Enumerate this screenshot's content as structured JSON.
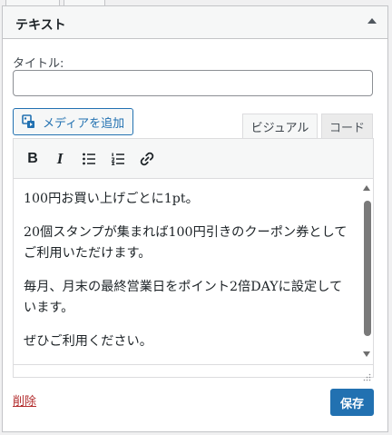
{
  "widget": {
    "title": "テキスト",
    "toggle_icon": "arrow-up-icon"
  },
  "form": {
    "title_label": "タイトル:",
    "title_value": "",
    "title_placeholder": ""
  },
  "media": {
    "button_label": "メディアを追加",
    "icon": "media-add-icon"
  },
  "editor": {
    "tabs": [
      {
        "label": "ビジュアル",
        "active": true
      },
      {
        "label": "コード",
        "active": false
      }
    ],
    "toolbar": [
      {
        "name": "bold",
        "glyph": "B"
      },
      {
        "name": "italic",
        "glyph": "I"
      },
      {
        "name": "bulleted-list",
        "icon": "bulleted-list-icon"
      },
      {
        "name": "numbered-list",
        "icon": "numbered-list-icon"
      },
      {
        "name": "link",
        "icon": "link-icon"
      }
    ],
    "paragraphs": [
      "100円お買い上げごとに1pt。",
      "20個スタンプが集まれば100円引きのクーポン券としてご利用いただけます。",
      "毎月、月末の最終営業日をポイント2倍DAYに設定しています。",
      "ぜひご利用ください。"
    ]
  },
  "actions": {
    "delete_label": "削除",
    "save_label": "保存"
  },
  "colors": {
    "accent": "#2271b1",
    "delete": "#b32d2e",
    "border": "#c3c4c7"
  }
}
